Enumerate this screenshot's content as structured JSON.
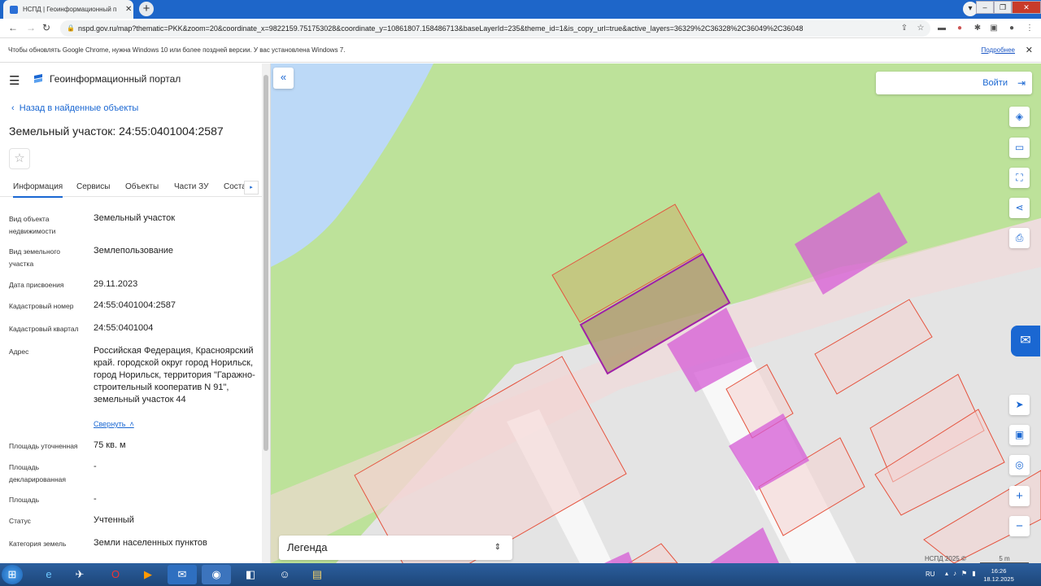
{
  "browser": {
    "tab_title": "НСПД | Геоинформационный п",
    "tab_close": "✕",
    "new_tab": "+",
    "url": "nspd.gov.ru/map?thematic=PKK&zoom=20&coordinate_x=9822159.751753028&coordinate_y=10861807.158486713&baseLayerId=235&theme_id=1&is_copy_url=true&active_layers=36329%2C36328%2C36049%2C36048"
  },
  "infobar": {
    "message": "Чтобы обновлять Google Chrome, нужна Windows 10 или более поздней версии. У вас установлена Windows 7.",
    "more_link": "Подробнее",
    "close": "✕"
  },
  "panel": {
    "menu_icon": "☰",
    "brand": "Геоинформационный портал",
    "back_link": "Назад в найденные объекты",
    "title": "Земельный участок: 24:55:0401004:2587",
    "star": "☆",
    "tabs": [
      "Информация",
      "Сервисы",
      "Объекты",
      "Части ЗУ",
      "Соста"
    ],
    "tabs_arrow": "▸",
    "properties": [
      {
        "label": "Вид объекта недвижимости",
        "value": "Земельный участок"
      },
      {
        "label": "Вид земельного участка",
        "value": "Землепользование"
      },
      {
        "label": "Дата присвоения",
        "value": "29.11.2023"
      },
      {
        "label": "Кадастровый номер",
        "value": "24:55:0401004:2587"
      },
      {
        "label": "Кадастровый квартал",
        "value": "24:55:0401004"
      },
      {
        "label": "Адрес",
        "value": "Российская Федерация, Красноярский край. городской округ город Норильск, город Норильск, территория \"Гаражно-строительный кооператив N 91\", земельный участок 44"
      },
      {
        "label": "Площадь уточненная",
        "value": "75 кв. м"
      },
      {
        "label": "Площадь декларированная",
        "value": "-"
      },
      {
        "label": "Площадь",
        "value": "-"
      },
      {
        "label": "Статус",
        "value": "Учтенный"
      },
      {
        "label": "Категория земель",
        "value": "Земли населенных пунктов"
      }
    ],
    "collapse_link": "Свернуть"
  },
  "map": {
    "collapse_button": "«",
    "login_label": "Войти",
    "tools": [
      "layers-icon",
      "ruler-icon",
      "select-area-icon",
      "share-icon",
      "print-icon",
      "locate-icon",
      "minimap-icon",
      "geolocation-icon"
    ],
    "zoom_in": "+",
    "zoom_out": "−",
    "legend_label": "Легенда",
    "copyright": "НСПД 2025 ©",
    "scale_label": "5 m",
    "colors": {
      "grass": "#bde29a",
      "water": "#bcd9f7",
      "parcel_fill": "#f4d2cf",
      "parcel_stroke": "#e5533e",
      "selected_fill": "#b49c78",
      "selected_stroke": "#a020a8",
      "building": "#d55bd6"
    }
  },
  "taskbar": {
    "lang": "RU",
    "time": "16:26",
    "date": "18.12.2025"
  }
}
